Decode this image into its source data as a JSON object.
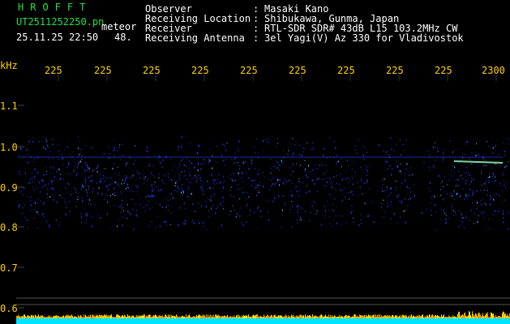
{
  "header": {
    "brand": "HROFFT",
    "filename": "UT2511252250.pn",
    "meteor_label": "meteor",
    "datetime": "25.11.25 22:50",
    "meteor_count": "48.",
    "fields": [
      {
        "label": "Observer",
        "sep": ":",
        "value": "Masaki Kano"
      },
      {
        "label": "Receiving Location",
        "sep": ":",
        "value": "Shibukawa, Gunma, Japan"
      },
      {
        "label": "Receiver",
        "sep": ":",
        "value": "RTL-SDR SDR# 43dB L15 103.2MHz CW"
      },
      {
        "label": "Receiving Antenna",
        "sep": ":",
        "value": "3el Yagi(V) Az 330 for Vladivostok"
      }
    ]
  },
  "axis": {
    "y_unit": "kHz",
    "y_ticks": [
      "1.1",
      "1.0",
      "0.9",
      "0.8",
      "0.7",
      "0.6"
    ],
    "x_ticks": [
      "225",
      "225",
      "225",
      "225",
      "225",
      "225",
      "225",
      "225",
      "225",
      "2300"
    ]
  },
  "colors": {
    "text_green": "#22e04a",
    "text_white": "#ffffff",
    "text_yellow": "#ffd200",
    "signal_blue": "#1e3cff",
    "baseline_cyan": "#00e5ff"
  }
}
